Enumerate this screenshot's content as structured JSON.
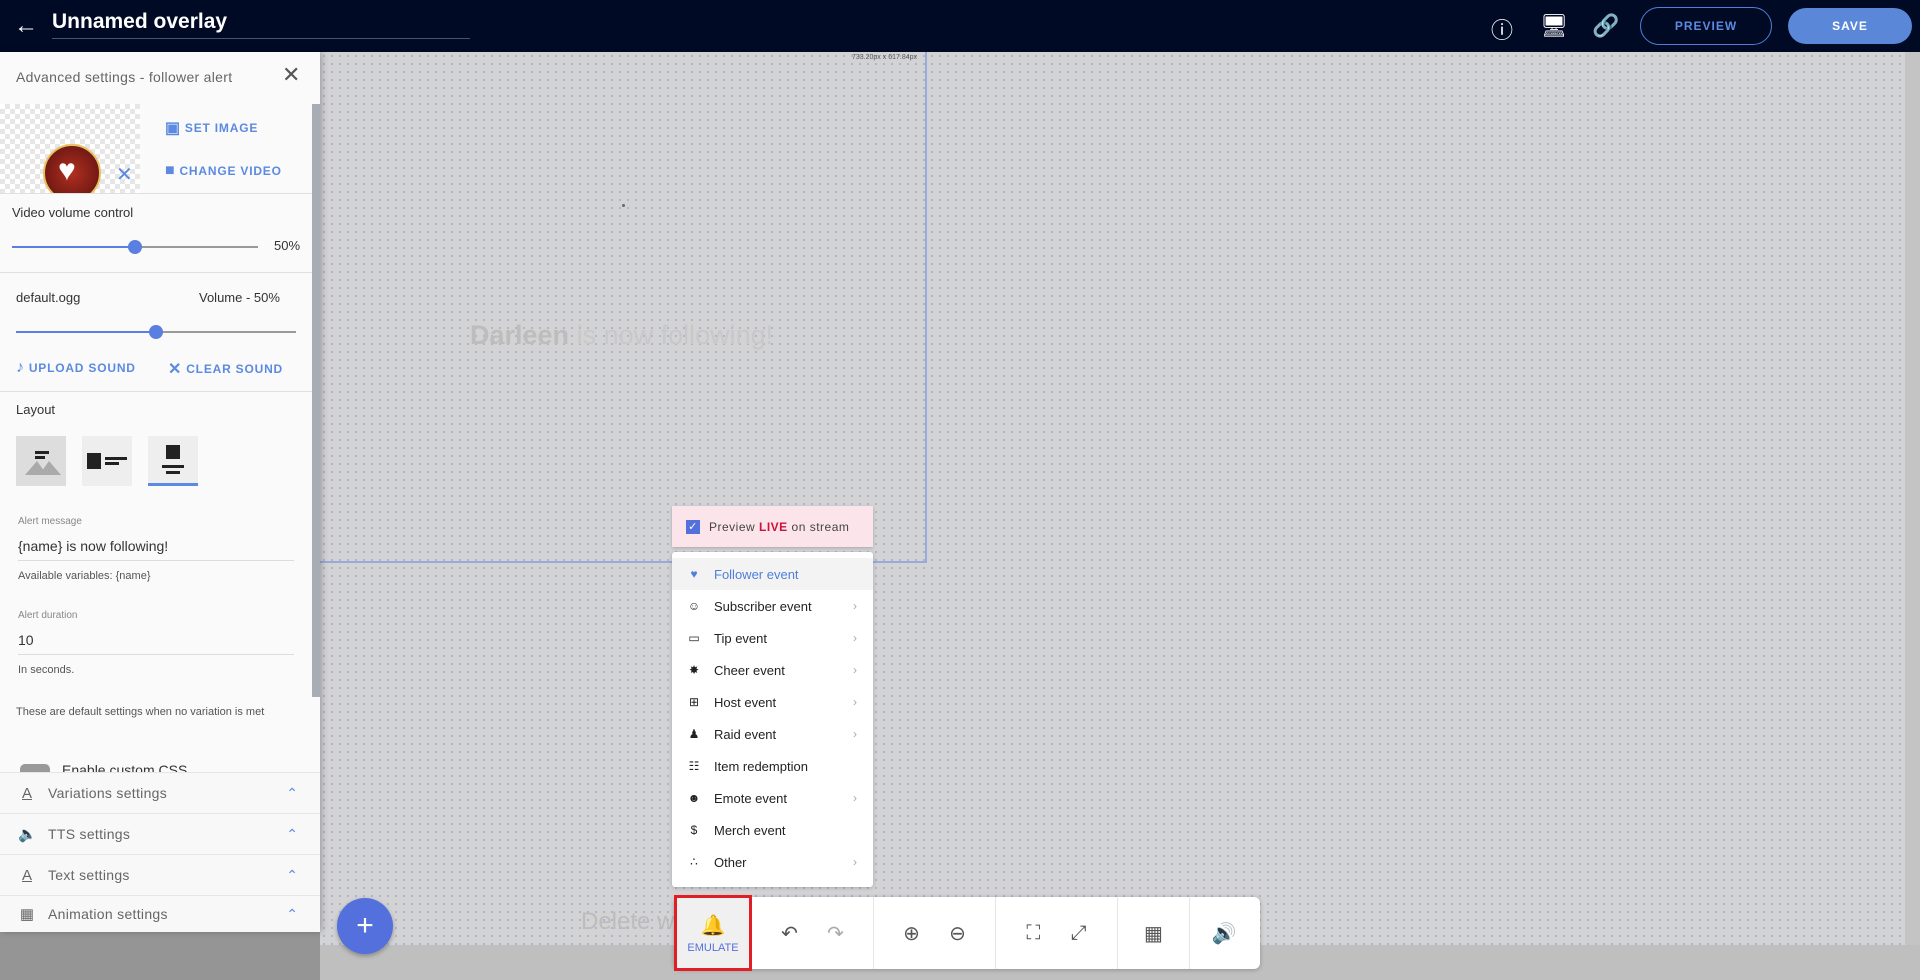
{
  "header": {
    "title": "Unnamed overlay",
    "preview_label": "PREVIEW",
    "save_label": "SAVE",
    "icons": [
      "back-arrow-icon",
      "help-icon",
      "monitor-settings-icon",
      "link-icon"
    ]
  },
  "panel": {
    "title": "Advanced settings - follower alert",
    "set_image": "SET IMAGE",
    "change_video": "CHANGE VIDEO",
    "video_volume_label": "Video volume control",
    "video_volume_value": "50%",
    "video_volume_percent": 50,
    "sound_file": "default.ogg",
    "sound_volume_label": "Volume - 50%",
    "sound_volume_percent": 50,
    "upload_sound": "UPLOAD SOUND",
    "clear_sound": "CLEAR SOUND",
    "layout_label": "Layout",
    "layout_selected": 3,
    "alert_message_label": "Alert message",
    "alert_message_value": "{name} is now following!",
    "alert_message_hint": "Available variables: {name}",
    "alert_duration_label": "Alert duration",
    "alert_duration_value": "10",
    "alert_duration_hint": "In seconds.",
    "default_note": "These are default settings when no variation is met",
    "custom_css_label": "Enable custom CSS",
    "sections": [
      {
        "label": "Variations settings",
        "icon": "text-format-icon"
      },
      {
        "label": "TTS settings",
        "icon": "speaker-icon"
      },
      {
        "label": "Text settings",
        "icon": "text-format-icon"
      },
      {
        "label": "Animation settings",
        "icon": "animation-icon"
      }
    ]
  },
  "canvas": {
    "dimensions": "733.20px x 617.84px",
    "alert_name": "Darleen",
    "alert_rest": " is now following!",
    "delete_hint": "Delete w"
  },
  "emulate": {
    "preview_prefix": "Preview ",
    "preview_live": "LIVE",
    "preview_suffix": " on stream",
    "preview_checked": true,
    "live_color": "#d0103a",
    "items": [
      {
        "label": "Follower event",
        "icon": "heart-icon",
        "submenu": false,
        "active": true
      },
      {
        "label": "Subscriber event",
        "icon": "subscriber-icon",
        "submenu": true
      },
      {
        "label": "Tip event",
        "icon": "credit-card-icon",
        "submenu": true
      },
      {
        "label": "Cheer event",
        "icon": "cheer-icon",
        "submenu": true
      },
      {
        "label": "Host event",
        "icon": "host-icon",
        "submenu": true
      },
      {
        "label": "Raid event",
        "icon": "raid-group-icon",
        "submenu": true
      },
      {
        "label": "Item redemption",
        "icon": "gift-icon",
        "submenu": false
      },
      {
        "label": "Emote event",
        "icon": "emote-icon",
        "submenu": true
      },
      {
        "label": "Merch event",
        "icon": "dollar-icon",
        "submenu": false
      },
      {
        "label": "Other",
        "icon": "other-dots-icon",
        "submenu": true
      }
    ]
  },
  "toolbar": {
    "emulate_label": "EMULATE",
    "accent": "#5470dc",
    "highlight": "#e01e26"
  }
}
